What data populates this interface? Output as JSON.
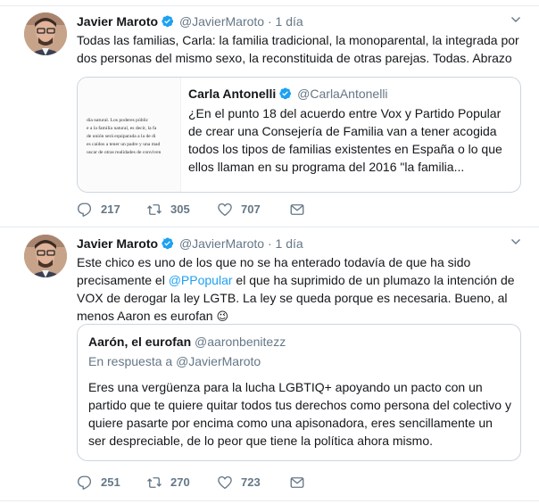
{
  "tweets": [
    {
      "author_name": "Javier Maroto",
      "author_handle": "@JavierMaroto",
      "separator": "·",
      "time": "1 día",
      "text": "Todas las familias, Carla: la familia tradicional, la monoparental, la integrada por dos personas del mismo sexo, la reconstituida de otras parejas. Todas. Abrazo",
      "quote": {
        "author_name": "Carla Antonelli",
        "author_handle": "@CarlaAntonelli",
        "text": "¿En el punto 18 del acuerdo entre Vox y Partido Popular de crear una Consejería de Familia van a tener acogida todos los tipos de familias existentes en España o lo que ellos llaman en su programa del 2016 \"la familia...",
        "thumb_lines": [
          "dia natural. Los poderes públic",
          "e a la familia natural, es decir, la fa",
          "de unión será equiparada a la de di",
          "es caídos a tener un padre y una mad",
          "uscar de otras realidades de conviven"
        ]
      },
      "actions": {
        "replies": "217",
        "retweets": "305",
        "likes": "707"
      }
    },
    {
      "author_name": "Javier Maroto",
      "author_handle": "@JavierMaroto",
      "separator": "·",
      "time": "1 día",
      "text_before_link": "Este chico es uno de los que no se ha enterado todavía de que ha sido precisamente el ",
      "link": "@PPopular",
      "text_after_link": " el que ha suprimido de un plumazo la intención de VOX de derogar la ley LGTB. La ley se queda porque es necesaria. Bueno, al menos Aaron es eurofan",
      "emoji": "😉",
      "quote": {
        "author_name": "Aarón, el eurofan",
        "author_handle": "@aaronbenitezz",
        "reply_prefix": "En respuesta a ",
        "reply_to": "@JavierMaroto",
        "text": "Eres una vergüenza para la lucha LGBTIQ+ apoyando un pacto con un partido que te quiere quitar todos tus derechos como persona del colectivo y quiere pasarte por encima como una apisonadora, eres sencillamente un ser despreciable, de lo peor que tiene la política ahora mismo."
      },
      "actions": {
        "replies": "251",
        "retweets": "270",
        "likes": "723"
      }
    }
  ],
  "colors": {
    "verified": "#1da1f2",
    "muted": "#657786",
    "link": "#1da1f2",
    "border": "#ccd6dd"
  },
  "icons": [
    "verified-badge-icon",
    "chevron-down-icon",
    "reply-icon",
    "retweet-icon",
    "like-icon",
    "message-icon"
  ]
}
